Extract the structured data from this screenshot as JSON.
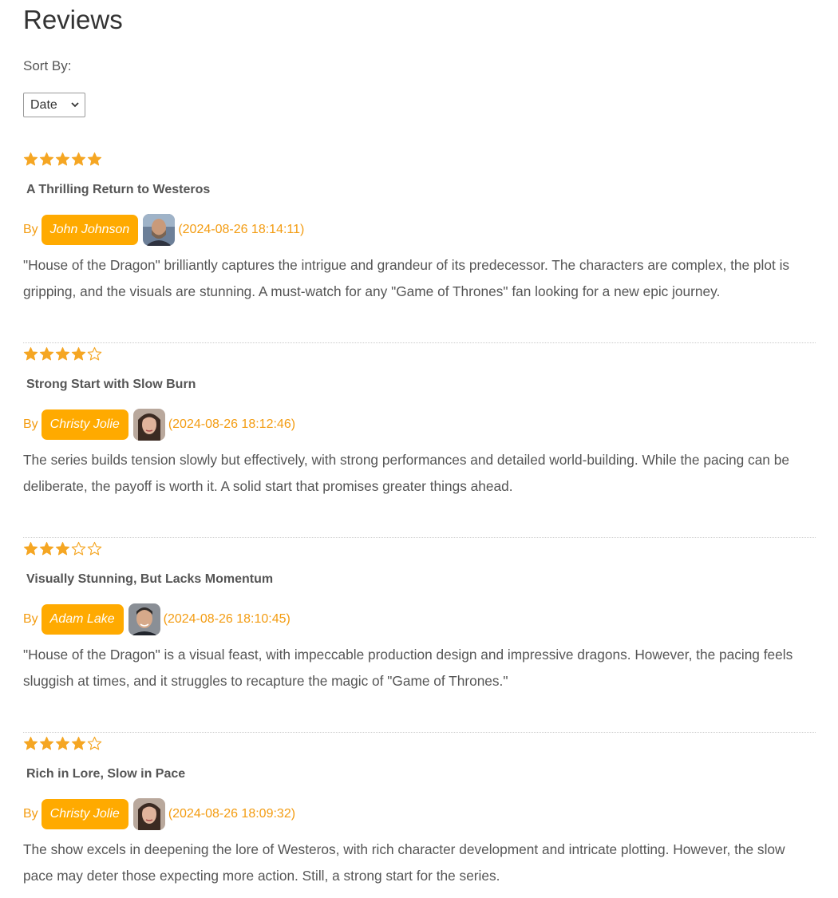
{
  "page": {
    "title": "Reviews"
  },
  "sort": {
    "label": "Sort By:",
    "selected": "Date"
  },
  "colors": {
    "accent": "#ffaa00",
    "star": "#f5a623",
    "date": "#f39c12"
  },
  "reviews": [
    {
      "rating": 5,
      "title": "A Thrilling Return to Westeros",
      "by": "By",
      "author": "John Johnson",
      "date": "(2024-08-26 18:14:11)",
      "body": "\"House of the Dragon\" brilliantly captures the intrigue and grandeur of its predecessor. The characters are complex, the plot is gripping, and the visuals are stunning. A must-watch for any \"Game of Thrones\" fan looking for a new epic journey."
    },
    {
      "rating": 4,
      "title": "Strong Start with Slow Burn",
      "by": "By",
      "author": "Christy Jolie",
      "date": "(2024-08-26 18:12:46)",
      "body": "The series builds tension slowly but effectively, with strong performances and detailed world-building. While the pacing can be deliberate, the payoff is worth it. A solid start that promises greater things ahead."
    },
    {
      "rating": 3,
      "title": "Visually Stunning, But Lacks Momentum",
      "by": "By",
      "author": "Adam Lake",
      "date": "(2024-08-26 18:10:45)",
      "body": "\"House of the Dragon\" is a visual feast, with impeccable production design and impressive dragons. However, the pacing feels sluggish at times, and it struggles to recapture the magic of \"Game of Thrones.\""
    },
    {
      "rating": 4,
      "title": "Rich in Lore, Slow in Pace",
      "by": "By",
      "author": "Christy Jolie",
      "date": "(2024-08-26 18:09:32)",
      "body": "The show excels in deepening the lore of Westeros, with rich character development and intricate plotting. However, the slow pace may deter those expecting more action. Still, a strong start for the series."
    }
  ]
}
